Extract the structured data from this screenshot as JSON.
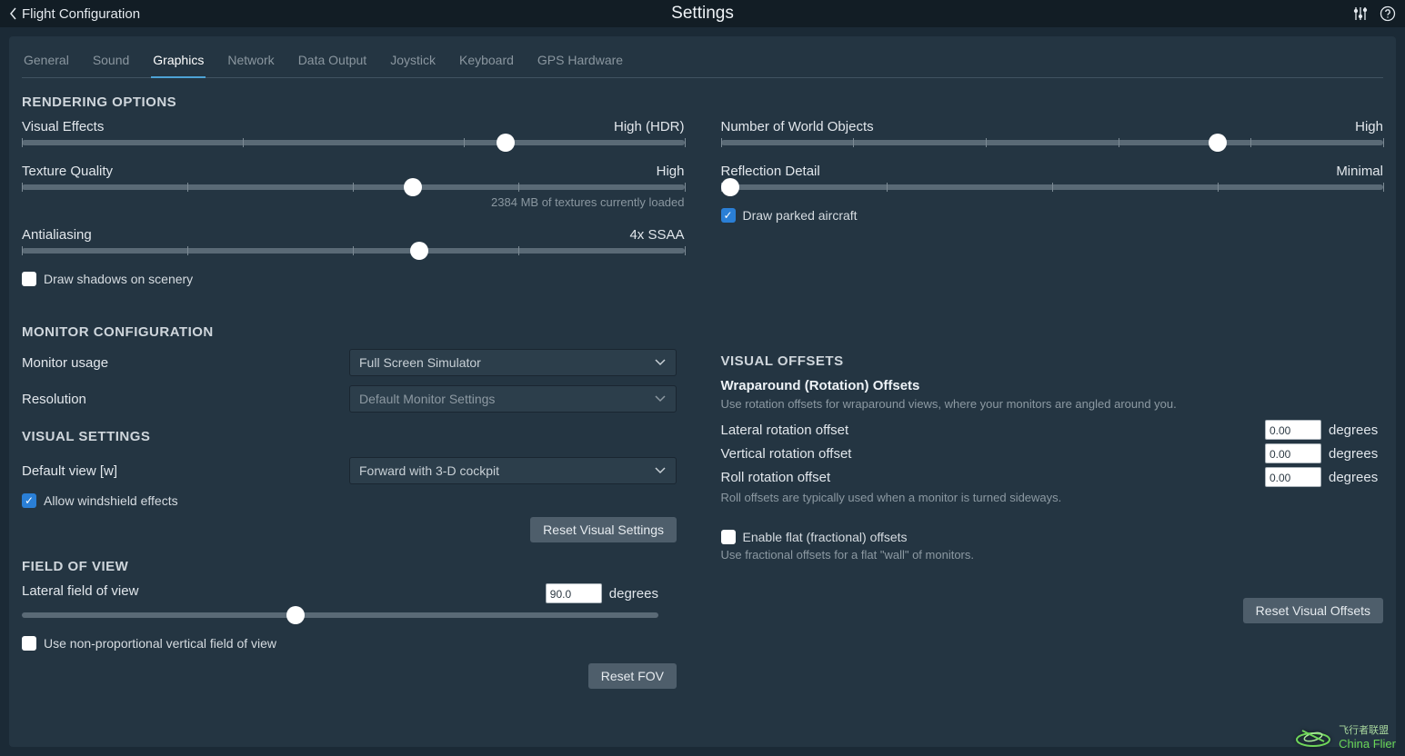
{
  "topbar": {
    "back_label": "Flight Configuration",
    "title": "Settings"
  },
  "tabs": [
    "General",
    "Sound",
    "Graphics",
    "Network",
    "Data Output",
    "Joystick",
    "Keyboard",
    "GPS Hardware"
  ],
  "active_tab": "Graphics",
  "sections": {
    "rendering": "RENDERING OPTIONS",
    "monitor": "MONITOR CONFIGURATION",
    "visual_settings": "VISUAL SETTINGS",
    "fov": "FIELD OF VIEW",
    "visual_offsets": "VISUAL OFFSETS"
  },
  "sliders": {
    "visual_effects": {
      "label": "Visual Effects",
      "value": "High (HDR)",
      "pos": 73
    },
    "texture_quality": {
      "label": "Texture Quality",
      "value": "High",
      "pos": 59,
      "note": "2384 MB of textures currently loaded"
    },
    "antialiasing": {
      "label": "Antialiasing",
      "value": "4x SSAA",
      "pos": 60
    },
    "world_objects": {
      "label": "Number of World Objects",
      "value": "High",
      "pos": 75
    },
    "reflection": {
      "label": "Reflection Detail",
      "value": "Minimal",
      "pos": 1.5
    },
    "lateral_fov": {
      "label": "Lateral field of view",
      "input": "90.0",
      "unit": "degrees",
      "pos": 43
    }
  },
  "checkboxes": {
    "shadows": {
      "label": "Draw shadows on scenery",
      "checked": false
    },
    "parked": {
      "label": "Draw parked aircraft",
      "checked": true
    },
    "windshield": {
      "label": "Allow windshield effects",
      "checked": true
    },
    "nonprop_fov": {
      "label": "Use non-proportional vertical field of view",
      "checked": false
    },
    "flat_offsets": {
      "label": "Enable flat (fractional) offsets",
      "checked": false
    }
  },
  "selects": {
    "monitor_usage": {
      "label": "Monitor usage",
      "value": "Full Screen Simulator"
    },
    "resolution": {
      "label": "Resolution",
      "value": "Default Monitor Settings"
    },
    "default_view": {
      "label": "Default view [w]",
      "value": "Forward with 3-D cockpit"
    }
  },
  "buttons": {
    "reset_visual": "Reset Visual Settings",
    "reset_fov": "Reset FOV",
    "reset_offsets": "Reset Visual Offsets"
  },
  "offsets": {
    "heading": "Wraparound (Rotation) Offsets",
    "hint": "Use rotation offsets for wraparound views, where your monitors are angled around you.",
    "lateral": {
      "label": "Lateral rotation offset",
      "value": "0.00",
      "unit": "degrees"
    },
    "vertical": {
      "label": "Vertical rotation offset",
      "value": "0.00",
      "unit": "degrees"
    },
    "roll": {
      "label": "Roll rotation offset",
      "value": "0.00",
      "unit": "degrees"
    },
    "roll_hint": "Roll offsets are typically used when a monitor is turned sideways.",
    "flat_hint": "Use fractional offsets for a flat \"wall\" of monitors."
  },
  "watermark": {
    "en": "China Flier",
    "cn": "飞行者联盟"
  }
}
